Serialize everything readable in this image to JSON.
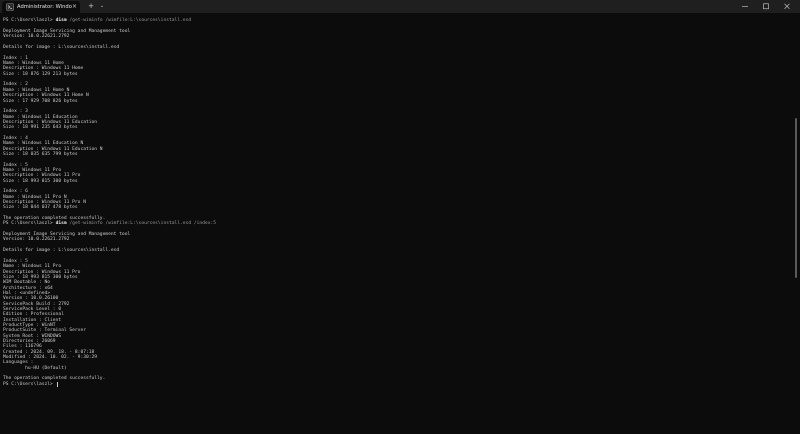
{
  "window": {
    "tab_title": "Administrator: Windows Pow",
    "close_glyph": "×",
    "new_tab_glyph": "+",
    "dropdown_glyph": "⌄"
  },
  "terminal": {
    "cmd1": {
      "prompt": "PS C:\\Users\\laszl> ",
      "command": "dism",
      "args": " /get-wiminfo /wimfile:L:\\sources\\install.esd"
    },
    "cmd2": {
      "prompt": "PS C:\\Users\\laszl> ",
      "command": "dism",
      "args": " /get-wiminfo /wimfile:L:\\sources\\install.esd /index:5"
    },
    "final_prompt": "PS C:\\Users\\laszl> ",
    "lines": {
      "tool_name": "Deployment Image Servicing and Management tool",
      "version": "Version: 10.0.22621.2792",
      "details": "Details for image : L:\\sources\\install.esd",
      "idx1": "Index : 1",
      "name1": "Name : Windows 11 Home",
      "desc1": "Description : Windows 11 Home",
      "size1": "Size : 18 876 129 213 bytes",
      "idx2": "Index : 2",
      "name2": "Name : Windows 11 Home N",
      "desc2": "Description : Windows 11 Home N",
      "size2": "Size : 17 929 708 826 bytes",
      "idx3": "Index : 3",
      "name3": "Name : Windows 11 Education",
      "desc3": "Description : Windows 11 Education",
      "size3": "Size : 18 991 235 643 bytes",
      "idx4": "Index : 4",
      "name4": "Name : Windows 11 Education N",
      "desc4": "Description : Windows 11 Education N",
      "size4": "Size : 18 035 635 799 bytes",
      "idx5": "Index : 5",
      "name5": "Name : Windows 11 Pro",
      "desc5": "Description : Windows 11 Pro",
      "size5": "Size : 18 993 815 300 bytes",
      "idx6": "Index : 6",
      "name6": "Name : Windows 11 Pro N",
      "desc6": "Description : Windows 11 Pro N",
      "size6": "Size : 18 044 037 478 bytes",
      "success": "The operation completed successfully.",
      "wim_bootable": "WIM Bootable : No",
      "architecture": "Architecture : x64",
      "hal": "Hal : <undefined>",
      "version_detail": "Version : 10.0.26100",
      "sp_build": "ServicePack Build : 2792",
      "sp_level": "ServicePack Level : 0",
      "edition": "Edition : Professional",
      "installation": "Installation : Client",
      "product_type": "ProductType : WinNT",
      "product_suite": "ProductSuite : Terminal Server",
      "system_root": "System Root : WINDOWS",
      "directories": "Directories : 26069",
      "files": "Files : 116796",
      "created": "Created : 2024. 09. 18. - 8:07:18",
      "modified": "Modified : 2024. 10. 02. - 9:30:29",
      "languages": "Languages :",
      "lang_value": "        hu-HU (Default)"
    }
  }
}
